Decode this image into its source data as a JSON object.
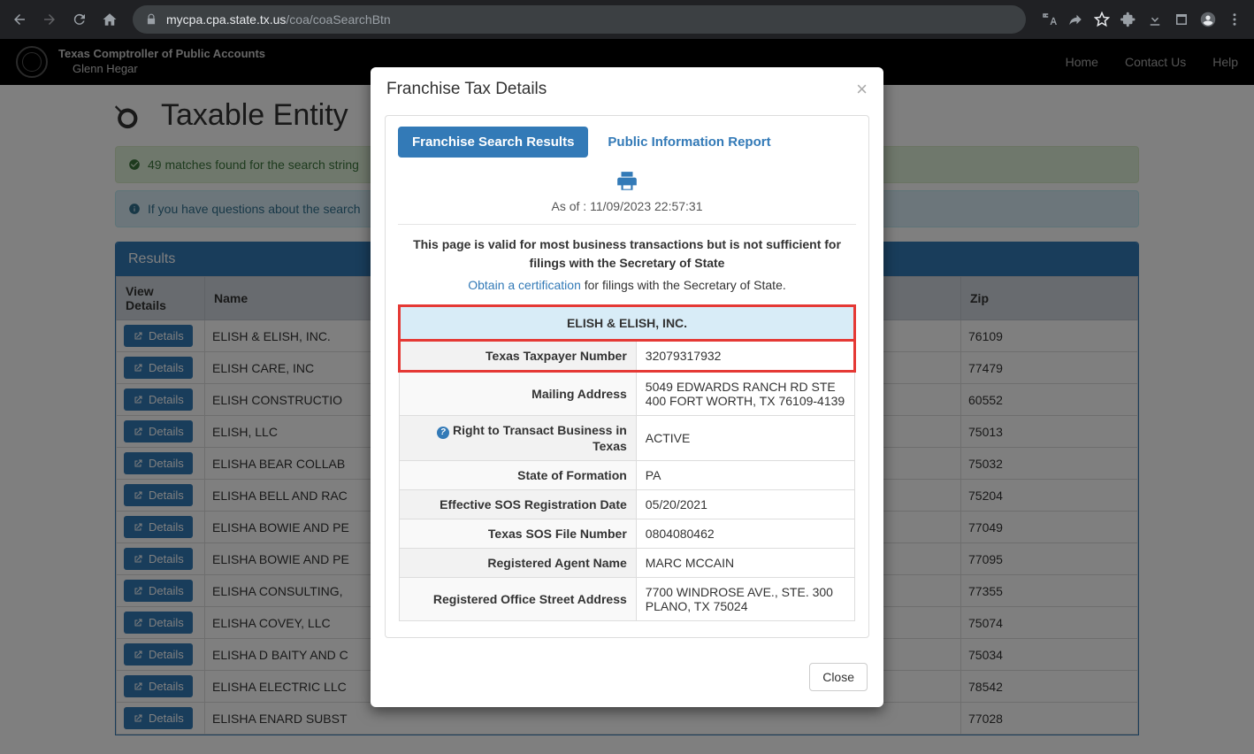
{
  "browser": {
    "url_host": "mycpa.cpa.state.tx.us",
    "url_path": "/coa/coaSearchBtn"
  },
  "header": {
    "org_name": "Texas Comptroller of Public Accounts",
    "org_person": "Glenn Hegar",
    "nav": {
      "home": "Home",
      "contact": "Contact Us",
      "help": "Help"
    }
  },
  "page": {
    "title": "Taxable Entity",
    "match_message": "49 matches found for the search string",
    "info_message": "If you have questions about the search"
  },
  "results": {
    "header": "Results",
    "columns": {
      "view": "View Details",
      "name": "Name",
      "zip": "Zip"
    },
    "button_label": "Details",
    "rows": [
      {
        "name": "ELISH & ELISH, INC.",
        "zip": "76109"
      },
      {
        "name": "ELISH CARE, INC",
        "zip": "77479"
      },
      {
        "name": "ELISH CONSTRUCTIO",
        "zip": "60552"
      },
      {
        "name": "ELISH, LLC",
        "zip": "75013"
      },
      {
        "name": "ELISHA BEAR COLLAB",
        "zip": "75032"
      },
      {
        "name": "ELISHA BELL AND RAC",
        "zip": "75204"
      },
      {
        "name": "ELISHA BOWIE AND PE",
        "zip": "77049"
      },
      {
        "name": "ELISHA BOWIE AND PE",
        "zip": "77095"
      },
      {
        "name": "ELISHA CONSULTING,",
        "zip": "77355"
      },
      {
        "name": "ELISHA COVEY, LLC",
        "zip": "75074"
      },
      {
        "name": "ELISHA D BAITY AND C",
        "zip": "75034"
      },
      {
        "name": "ELISHA ELECTRIC LLC",
        "zip": "78542"
      },
      {
        "name": "ELISHA ENARD SUBST",
        "zip": "77028"
      }
    ]
  },
  "modal": {
    "title": "Franchise Tax Details",
    "close_label": "Close",
    "tabs": {
      "franchise": "Franchise Search Results",
      "pir": "Public Information Report"
    },
    "asof_prefix": "As of : ",
    "asof": "11/09/2023 22:57:31",
    "disclaimer": "This page is valid for most business transactions but is not sufficient for filings with the Secretary of State",
    "cert_link": "Obtain a certification",
    "cert_suffix": " for filings with the Secretary of State.",
    "entity_name": "ELISH & ELISH, INC.",
    "fields": {
      "taxpayer_label": "Texas Taxpayer Number",
      "taxpayer_value": "32079317932",
      "mailing_label": "Mailing Address",
      "mailing_value": "5049 EDWARDS RANCH RD STE 400 FORT WORTH, TX 76109-4139",
      "rtb_label": "Right to Transact Business in Texas",
      "rtb_value": "ACTIVE",
      "formation_label": "State of Formation",
      "formation_value": "PA",
      "sos_date_label": "Effective SOS Registration Date",
      "sos_date_value": "05/20/2021",
      "sos_file_label": "Texas SOS File Number",
      "sos_file_value": "0804080462",
      "agent_label": "Registered Agent Name",
      "agent_value": "MARC MCCAIN",
      "office_label": "Registered Office Street Address",
      "office_value": "7700 WINDROSE AVE., STE. 300 PLANO, TX 75024"
    }
  }
}
